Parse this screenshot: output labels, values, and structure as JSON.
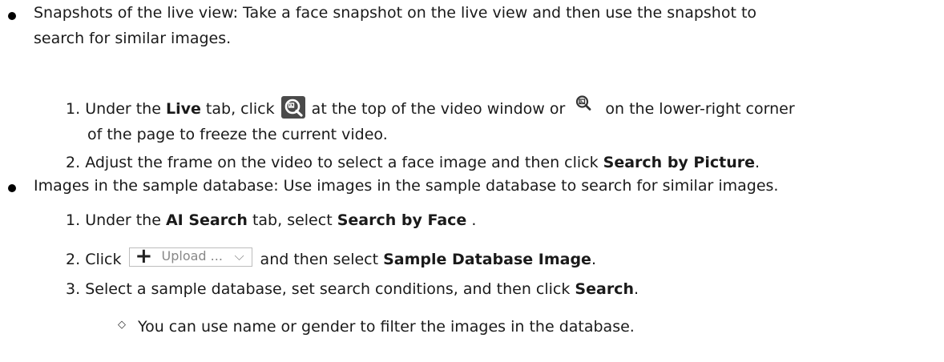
{
  "bullet1": {
    "lead": "Snapshots of the live view: Take a face snapshot on the live view and then use the snapshot to",
    "cont": "search for similar images.",
    "steps": [
      {
        "num": "1.",
        "pre": "Under the ",
        "tab": "Live",
        "mid1": "  tab, click ",
        "mid2": " at the top of the video window or ",
        "post": " on the lower-right corner",
        "cont": "of the page to freeze the current video."
      },
      {
        "num": "2.",
        "pre": "Adjust the frame on the video to select a face image and then click ",
        "bold": "Search by Picture",
        "post": "."
      }
    ]
  },
  "bullet2": {
    "lead": "Images in the sample database: Use images in the sample database to search for similar images.",
    "steps": [
      {
        "num": "1.",
        "pre": "Under the ",
        "tab": "AI Search",
        "mid": "  tab, select ",
        "bold": "Search by Face",
        "post": " ."
      },
      {
        "num": "2.",
        "pre": "Click ",
        "mid": " and then select ",
        "bold": "Sample Database Image",
        "post": "."
      },
      {
        "num": "3.",
        "pre": "Select a sample database, set search conditions, and then click ",
        "bold": "Search",
        "post": "."
      }
    ],
    "sub_note": "You can use name or gender to filter the images in the database."
  },
  "upload_button": {
    "plus": "+",
    "label": "Upload ...",
    "chevron": "⌵"
  },
  "icons": {
    "freeze_dark": "image-search-icon",
    "freeze_plain": "image-search-icon",
    "diamond": "◇"
  }
}
